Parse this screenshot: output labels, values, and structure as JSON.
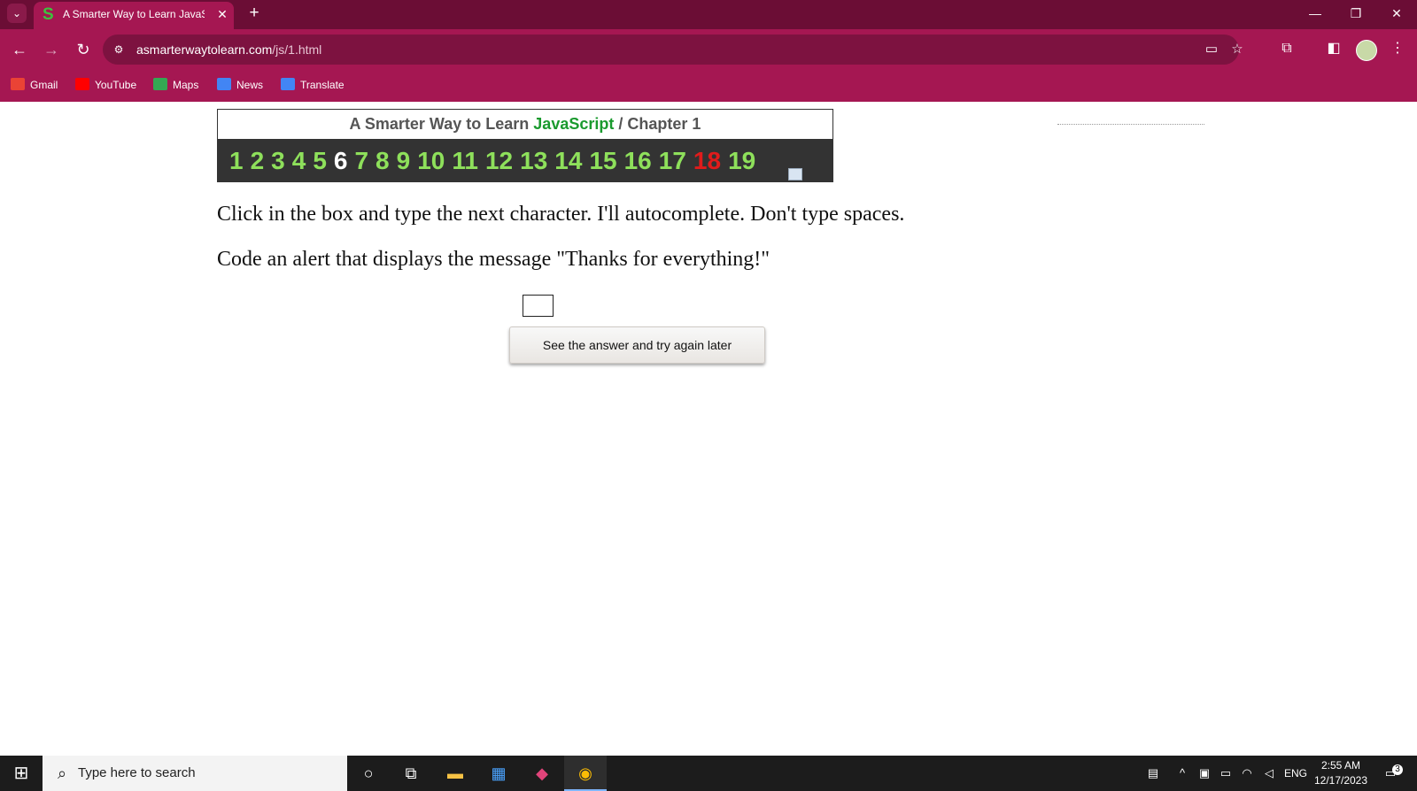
{
  "browser": {
    "tab": {
      "title": "A Smarter Way to Learn JavaScript",
      "favicon": "S",
      "close": "✕"
    },
    "new_tab": "+",
    "window_controls": {
      "minimize": "—",
      "restore": "❐",
      "close": "✕"
    },
    "url": {
      "host": "asmarterwaytolearn.com",
      "path": "/js/1.html"
    },
    "bookmarks": [
      {
        "label": "Gmail",
        "icon": "gmail-icon",
        "color": "#ea4335"
      },
      {
        "label": "YouTube",
        "icon": "youtube-icon",
        "color": "#ff0000"
      },
      {
        "label": "Maps",
        "icon": "maps-icon",
        "color": "#34a853"
      },
      {
        "label": "News",
        "icon": "news-icon",
        "color": "#4285f4"
      },
      {
        "label": "Translate",
        "icon": "translate-icon",
        "color": "#4285f4"
      }
    ]
  },
  "page": {
    "header": {
      "prefix": "A Smarter Way to Learn",
      "language": "JavaScript",
      "separator": "/",
      "chapter": "Chapter 1"
    },
    "chapters": [
      "1",
      "2",
      "3",
      "4",
      "5",
      "6",
      "7",
      "8",
      "9",
      "10",
      "11",
      "12",
      "13",
      "14",
      "15",
      "16",
      "17",
      "18",
      "19"
    ],
    "current_chapter": "6",
    "highlight_chapter": "18",
    "instruction": "Click in the box and type the next character. I'll autocomplete. Don't type spaces.",
    "prompt": "Code an alert that displays the message \"Thanks for everything!\"",
    "answer_value": "",
    "see_answer_button": "See the answer and try again later"
  },
  "taskbar": {
    "search_placeholder": "Type here to search",
    "language": "ENG",
    "time": "2:55 AM",
    "date": "12/17/2023",
    "notifications": "3"
  }
}
